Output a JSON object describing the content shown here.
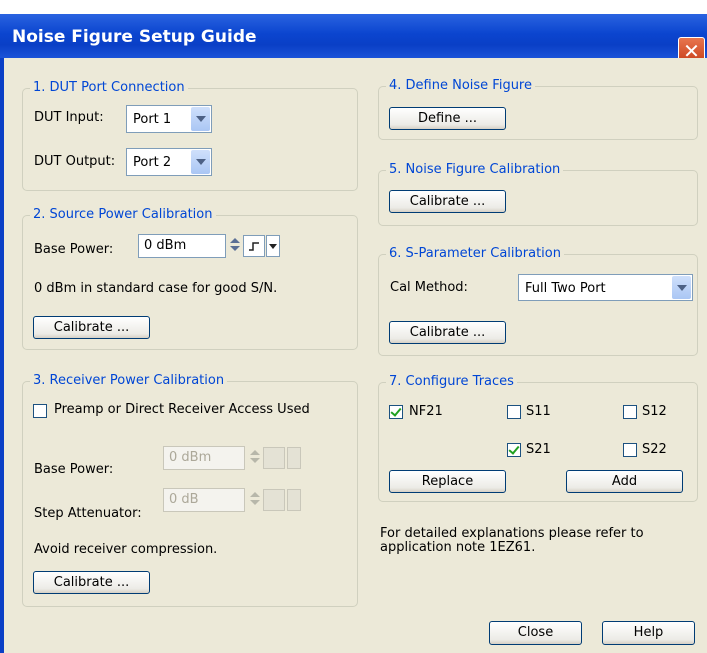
{
  "window": {
    "title": "Noise Figure Setup Guide",
    "close_glyph": "✕"
  },
  "group1": {
    "title": "1. DUT Port Connection",
    "dut_input_label": "DUT Input:",
    "dut_input_value": "Port 1",
    "dut_output_label": "DUT Output:",
    "dut_output_value": "Port 2"
  },
  "group2": {
    "title": "2. Source Power Calibration",
    "base_power_label": "Base Power:",
    "base_power_value": "0 dBm",
    "note": "0 dBm in standard case for good S/N.",
    "calibrate_label": "Calibrate ..."
  },
  "group3": {
    "title": "3. Receiver Power Calibration",
    "preamp_label": "Preamp or Direct Receiver Access Used",
    "preamp_checked": false,
    "base_power_label": "Base Power:",
    "base_power_value": "0 dBm",
    "step_att_label": "Step Attenuator:",
    "step_att_value": "0 dB",
    "note": "Avoid receiver compression.",
    "calibrate_label": "Calibrate ..."
  },
  "group4": {
    "title": "4. Define Noise Figure",
    "define_label": "Define ..."
  },
  "group5": {
    "title": "5. Noise Figure Calibration",
    "calibrate_label": "Calibrate ..."
  },
  "group6": {
    "title": "6. S-Parameter Calibration",
    "cal_method_label": "Cal Method:",
    "cal_method_value": "Full Two Port",
    "calibrate_label": "Calibrate ..."
  },
  "group7": {
    "title": "7. Configure Traces",
    "traces": [
      {
        "label": "NF21",
        "checked": true
      },
      {
        "label": "S11",
        "checked": false
      },
      {
        "label": "S12",
        "checked": false
      },
      {
        "label": "S21",
        "checked": true
      },
      {
        "label": "S22",
        "checked": false
      }
    ],
    "replace_label": "Replace",
    "add_label": "Add"
  },
  "info_text_line1": "For detailed explanations please refer to",
  "info_text_line2": "application note 1EZ61.",
  "footer": {
    "close_label": "Close",
    "help_label": "Help"
  }
}
